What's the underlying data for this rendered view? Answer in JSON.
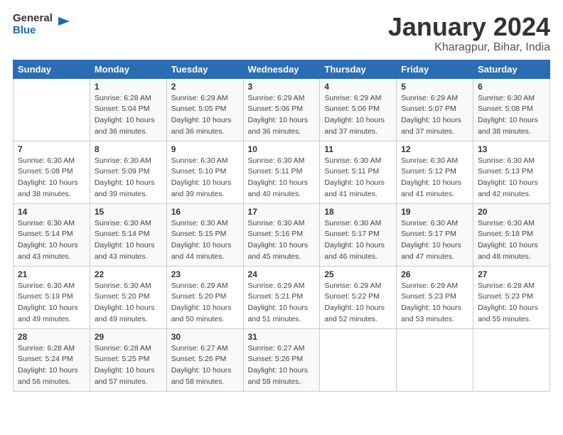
{
  "header": {
    "logo_line1": "General",
    "logo_line2": "Blue",
    "title": "January 2024",
    "subtitle": "Kharagpur, Bihar, India"
  },
  "days_of_week": [
    "Sunday",
    "Monday",
    "Tuesday",
    "Wednesday",
    "Thursday",
    "Friday",
    "Saturday"
  ],
  "weeks": [
    [
      {
        "day": "",
        "sunrise": "",
        "sunset": "",
        "daylight": ""
      },
      {
        "day": "1",
        "sunrise": "6:28 AM",
        "sunset": "5:04 PM",
        "daylight": "10 hours and 36 minutes."
      },
      {
        "day": "2",
        "sunrise": "6:29 AM",
        "sunset": "5:05 PM",
        "daylight": "10 hours and 36 minutes."
      },
      {
        "day": "3",
        "sunrise": "6:29 AM",
        "sunset": "5:06 PM",
        "daylight": "10 hours and 36 minutes."
      },
      {
        "day": "4",
        "sunrise": "6:29 AM",
        "sunset": "5:06 PM",
        "daylight": "10 hours and 37 minutes."
      },
      {
        "day": "5",
        "sunrise": "6:29 AM",
        "sunset": "5:07 PM",
        "daylight": "10 hours and 37 minutes."
      },
      {
        "day": "6",
        "sunrise": "6:30 AM",
        "sunset": "5:08 PM",
        "daylight": "10 hours and 38 minutes."
      }
    ],
    [
      {
        "day": "7",
        "sunrise": "6:30 AM",
        "sunset": "5:08 PM",
        "daylight": "10 hours and 38 minutes."
      },
      {
        "day": "8",
        "sunrise": "6:30 AM",
        "sunset": "5:09 PM",
        "daylight": "10 hours and 39 minutes."
      },
      {
        "day": "9",
        "sunrise": "6:30 AM",
        "sunset": "5:10 PM",
        "daylight": "10 hours and 39 minutes."
      },
      {
        "day": "10",
        "sunrise": "6:30 AM",
        "sunset": "5:11 PM",
        "daylight": "10 hours and 40 minutes."
      },
      {
        "day": "11",
        "sunrise": "6:30 AM",
        "sunset": "5:11 PM",
        "daylight": "10 hours and 41 minutes."
      },
      {
        "day": "12",
        "sunrise": "6:30 AM",
        "sunset": "5:12 PM",
        "daylight": "10 hours and 41 minutes."
      },
      {
        "day": "13",
        "sunrise": "6:30 AM",
        "sunset": "5:13 PM",
        "daylight": "10 hours and 42 minutes."
      }
    ],
    [
      {
        "day": "14",
        "sunrise": "6:30 AM",
        "sunset": "5:14 PM",
        "daylight": "10 hours and 43 minutes."
      },
      {
        "day": "15",
        "sunrise": "6:30 AM",
        "sunset": "5:14 PM",
        "daylight": "10 hours and 43 minutes."
      },
      {
        "day": "16",
        "sunrise": "6:30 AM",
        "sunset": "5:15 PM",
        "daylight": "10 hours and 44 minutes."
      },
      {
        "day": "17",
        "sunrise": "6:30 AM",
        "sunset": "5:16 PM",
        "daylight": "10 hours and 45 minutes."
      },
      {
        "day": "18",
        "sunrise": "6:30 AM",
        "sunset": "5:17 PM",
        "daylight": "10 hours and 46 minutes."
      },
      {
        "day": "19",
        "sunrise": "6:30 AM",
        "sunset": "5:17 PM",
        "daylight": "10 hours and 47 minutes."
      },
      {
        "day": "20",
        "sunrise": "6:30 AM",
        "sunset": "5:18 PM",
        "daylight": "10 hours and 48 minutes."
      }
    ],
    [
      {
        "day": "21",
        "sunrise": "6:30 AM",
        "sunset": "5:19 PM",
        "daylight": "10 hours and 49 minutes."
      },
      {
        "day": "22",
        "sunrise": "6:30 AM",
        "sunset": "5:20 PM",
        "daylight": "10 hours and 49 minutes."
      },
      {
        "day": "23",
        "sunrise": "6:29 AM",
        "sunset": "5:20 PM",
        "daylight": "10 hours and 50 minutes."
      },
      {
        "day": "24",
        "sunrise": "6:29 AM",
        "sunset": "5:21 PM",
        "daylight": "10 hours and 51 minutes."
      },
      {
        "day": "25",
        "sunrise": "6:29 AM",
        "sunset": "5:22 PM",
        "daylight": "10 hours and 52 minutes."
      },
      {
        "day": "26",
        "sunrise": "6:29 AM",
        "sunset": "5:23 PM",
        "daylight": "10 hours and 53 minutes."
      },
      {
        "day": "27",
        "sunrise": "6:28 AM",
        "sunset": "5:23 PM",
        "daylight": "10 hours and 55 minutes."
      }
    ],
    [
      {
        "day": "28",
        "sunrise": "6:28 AM",
        "sunset": "5:24 PM",
        "daylight": "10 hours and 56 minutes."
      },
      {
        "day": "29",
        "sunrise": "6:28 AM",
        "sunset": "5:25 PM",
        "daylight": "10 hours and 57 minutes."
      },
      {
        "day": "30",
        "sunrise": "6:27 AM",
        "sunset": "5:26 PM",
        "daylight": "10 hours and 58 minutes."
      },
      {
        "day": "31",
        "sunrise": "6:27 AM",
        "sunset": "5:26 PM",
        "daylight": "10 hours and 59 minutes."
      },
      {
        "day": "",
        "sunrise": "",
        "sunset": "",
        "daylight": ""
      },
      {
        "day": "",
        "sunrise": "",
        "sunset": "",
        "daylight": ""
      },
      {
        "day": "",
        "sunrise": "",
        "sunset": "",
        "daylight": ""
      }
    ]
  ],
  "labels": {
    "sunrise_prefix": "Sunrise: ",
    "sunset_prefix": "Sunset: ",
    "daylight_prefix": "Daylight: "
  }
}
